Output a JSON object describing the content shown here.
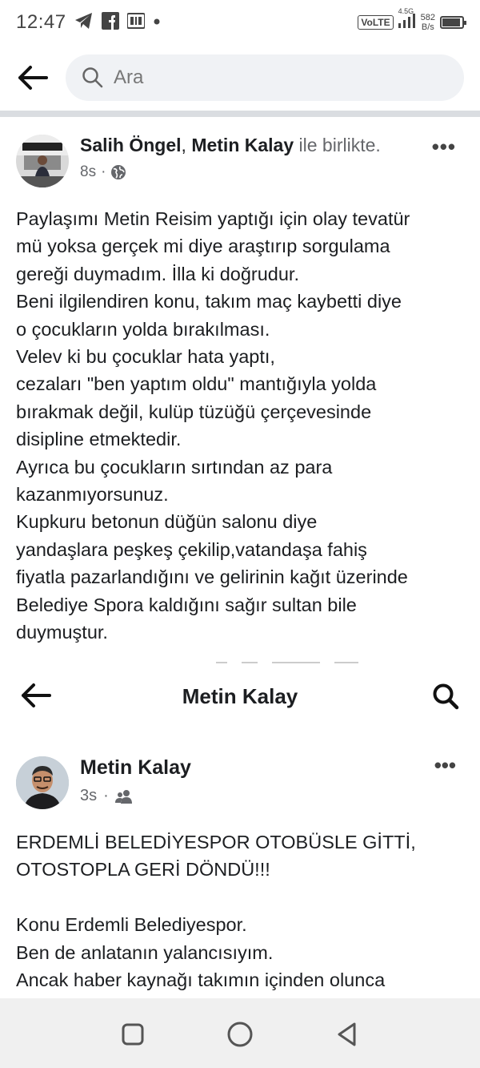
{
  "status_bar": {
    "time": "12:47",
    "volte": "VoLTE",
    "network_type": "4.5G",
    "net_speed_value": "582",
    "net_speed_unit": "B/s",
    "battery_level": 0.9,
    "left_icons": [
      "telegram-icon",
      "facebook-icon",
      "tv-icon",
      "dot-icon"
    ]
  },
  "search_header": {
    "placeholder": "Ara"
  },
  "post": {
    "author_1": "Salih Öngel",
    "separator": ",",
    "author_2": "Metin Kalay",
    "with_text": "ile birlikte.",
    "timestamp": "8s",
    "privacy_icon": "globe-icon",
    "more_label": "•••",
    "body_lines": [
      "Paylaşımı Metin Reisim yaptığı için olay tevatür",
      "mü yoksa gerçek mi diye araştırıp sorgulama",
      "gereği duymadım. İlla ki doğrudur.",
      "Beni ilgilendiren konu, takım maç kaybetti diye",
      "o çocukların yolda bırakılması.",
      "Velev ki bu çocuklar hata yaptı,",
      "cezaları \"ben yaptım oldu\" mantığıyla yolda",
      "bırakmak değil, kulüp tüzüğü çerçevesinde",
      "disipline etmektedir.",
      "Ayrıca bu çocukların sırtından az para",
      "kazanmıyorsunuz.",
      "Kupkuru betonun düğün salonu diye",
      "yandaşlara peşkeş çekilip,vatandaşa fahiş",
      "fiyatla pazarlandığını ve gelirinin kağıt üzerinde",
      "Belediye Spora kaldığını sağır sultan bile",
      "duymuştur."
    ]
  },
  "embedded": {
    "nav_title": "Metin Kalay",
    "author": "Metin Kalay",
    "timestamp": "3s",
    "audience_icon": "friends-icon",
    "more_label": "•••",
    "body_lines": [
      "ERDEMLİ BELEDİYESPOR OTOBÜSLE GİTTİ,",
      "OTOSTOPLA GERİ DÖNDÜ!!!",
      "",
      "Konu Erdemli Belediyespor.",
      "Ben de anlatanın yalancısıyım.",
      "Ancak haber kaynağı takımın içinden olunca"
    ]
  },
  "nav_bar": {
    "buttons": [
      "recents-square-icon",
      "home-circle-icon",
      "back-triangle-icon"
    ]
  }
}
